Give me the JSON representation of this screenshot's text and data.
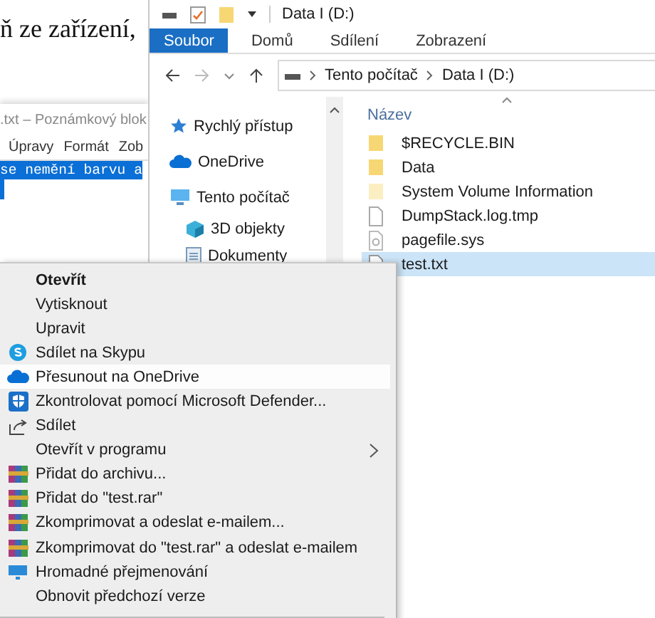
{
  "document": {
    "text": "ň ze zařízení,"
  },
  "notepad": {
    "title": ".txt – Poznámkový blok",
    "menu": [
      "Úpravy",
      "Formát",
      "Zob"
    ],
    "lines": [
      {
        "text": "se nemění barvu a",
        "selected": true
      }
    ]
  },
  "explorer": {
    "title": "Data I (D:)",
    "ribbon_tabs": [
      {
        "label": "Soubor",
        "selected": true
      },
      {
        "label": "Domů",
        "selected": false
      },
      {
        "label": "Sdílení",
        "selected": false
      },
      {
        "label": "Zobrazení",
        "selected": false
      }
    ],
    "breadcrumb": [
      "Tento počítač",
      "Data I (D:)"
    ],
    "nav_items": [
      {
        "label": "Rychlý přístup",
        "kind": "star"
      },
      {
        "label": "OneDrive",
        "kind": "cloud"
      },
      {
        "label": "Tento počítač",
        "kind": "pc",
        "children": [
          {
            "label": "3D objekty",
            "kind": "cube"
          },
          {
            "label": "Dokumenty",
            "kind": "doc"
          }
        ]
      }
    ],
    "column": "Název",
    "files": [
      {
        "name": "$RECYCLE.BIN",
        "kind": "folder",
        "selected": false
      },
      {
        "name": "Data",
        "kind": "folder",
        "selected": false
      },
      {
        "name": "System Volume Information",
        "kind": "hidden-folder",
        "selected": false
      },
      {
        "name": "DumpStack.log.tmp",
        "kind": "file",
        "selected": false
      },
      {
        "name": "pagefile.sys",
        "kind": "sys",
        "selected": false
      },
      {
        "name": "test.txt",
        "kind": "text",
        "selected": true
      }
    ]
  },
  "context_menu": [
    {
      "label": "Otevřít",
      "kind": "plain",
      "default": true,
      "submenu": false,
      "selected": false
    },
    {
      "label": "Vytisknout",
      "kind": "plain",
      "default": false,
      "submenu": false,
      "selected": false
    },
    {
      "label": "Upravit",
      "kind": "plain",
      "default": false,
      "submenu": false,
      "selected": false
    },
    {
      "label": "Sdílet na Skypu",
      "kind": "skype",
      "default": false,
      "submenu": false,
      "selected": false
    },
    {
      "label": "Přesunout na OneDrive",
      "kind": "cloud",
      "default": false,
      "submenu": false,
      "selected": true
    },
    {
      "label": "Zkontrolovat pomocí Microsoft Defender...",
      "kind": "shield",
      "default": false,
      "submenu": false,
      "selected": false
    },
    {
      "label": "Sdílet",
      "kind": "share",
      "default": false,
      "submenu": false,
      "selected": false
    },
    {
      "label": "Otevřít v programu",
      "kind": "plain",
      "default": false,
      "submenu": true,
      "selected": false
    },
    {
      "label": "Přidat do archivu...",
      "kind": "archive",
      "default": false,
      "submenu": false,
      "selected": false
    },
    {
      "label": "Přidat do \"test.rar\"",
      "kind": "archive",
      "default": false,
      "submenu": false,
      "selected": false
    },
    {
      "label": "Zkomprimovat a odeslat e-mailem...",
      "kind": "archive",
      "default": false,
      "submenu": false,
      "selected": false
    },
    {
      "label": "Zkomprimovat do \"test.rar\" a odeslat e-mailem",
      "kind": "archive",
      "default": false,
      "submenu": false,
      "selected": false
    },
    {
      "label": "Hromadné přejmenování",
      "kind": "rename",
      "default": false,
      "submenu": false,
      "selected": false
    },
    {
      "label": "Obnovit předchozí verze",
      "kind": "plain",
      "default": false,
      "submenu": false,
      "selected": false
    }
  ]
}
